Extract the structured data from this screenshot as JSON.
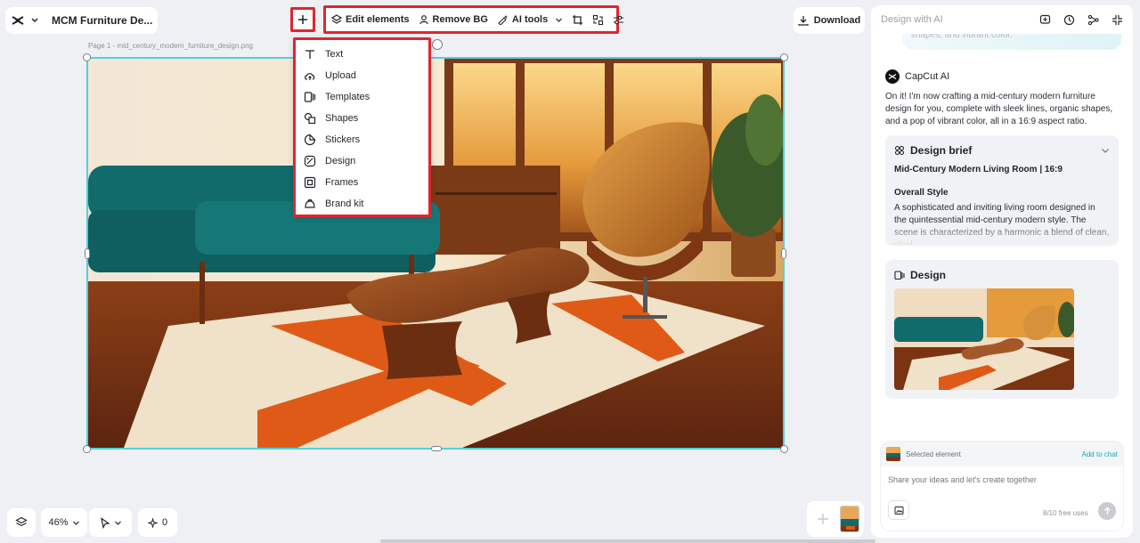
{
  "project": {
    "title": "MCM Furniture De..."
  },
  "toolbar": {
    "edit_elements": "Edit elements",
    "remove_bg": "Remove BG",
    "ai_tools": "AI tools"
  },
  "download": {
    "label": "Download"
  },
  "canvas": {
    "page_label": "Page 1 -   mid_century_modern_furniture_design.png"
  },
  "insert_menu": {
    "items": [
      {
        "label": "Text",
        "icon": "text-icon"
      },
      {
        "label": "Upload",
        "icon": "cloud-upload-icon"
      },
      {
        "label": "Templates",
        "icon": "templates-icon"
      },
      {
        "label": "Shapes",
        "icon": "shapes-icon"
      },
      {
        "label": "Stickers",
        "icon": "sticker-icon"
      },
      {
        "label": "Design",
        "icon": "design-icon"
      },
      {
        "label": "Frames",
        "icon": "frame-icon"
      },
      {
        "label": "Brand kit",
        "icon": "brand-kit-icon"
      }
    ]
  },
  "bottom": {
    "zoom": "46%",
    "ai_count": "0"
  },
  "panel": {
    "title": "Design with AI",
    "prev_bubble": "shapes, and vibrant color.",
    "ai_name": "CapCut AI",
    "ai_message": "On it! I'm now crafting a mid-century modern furniture design for you, complete with sleek lines, organic shapes, and a pop of vibrant color, all in a 16:9 aspect ratio.",
    "brief": {
      "heading": "Design brief",
      "subtitle": "Mid-Century Modern Living Room | 16:9",
      "section": "Overall Style",
      "body": "A sophisticated and inviting living room designed in the quintessential mid-century modern style. The scene is characterized by a harmonic a blend of clean, sleel"
    },
    "design": {
      "heading": "Design"
    },
    "chat": {
      "selected": "Selected element",
      "add_to_chat": "Add to chat",
      "placeholder": "Share your ideas and let's create together",
      "free_uses": "8/10 free uses"
    }
  },
  "colors": {
    "accent": "#19a8b9",
    "highlight": "#e0252f",
    "selection": "#4fd1e0"
  }
}
